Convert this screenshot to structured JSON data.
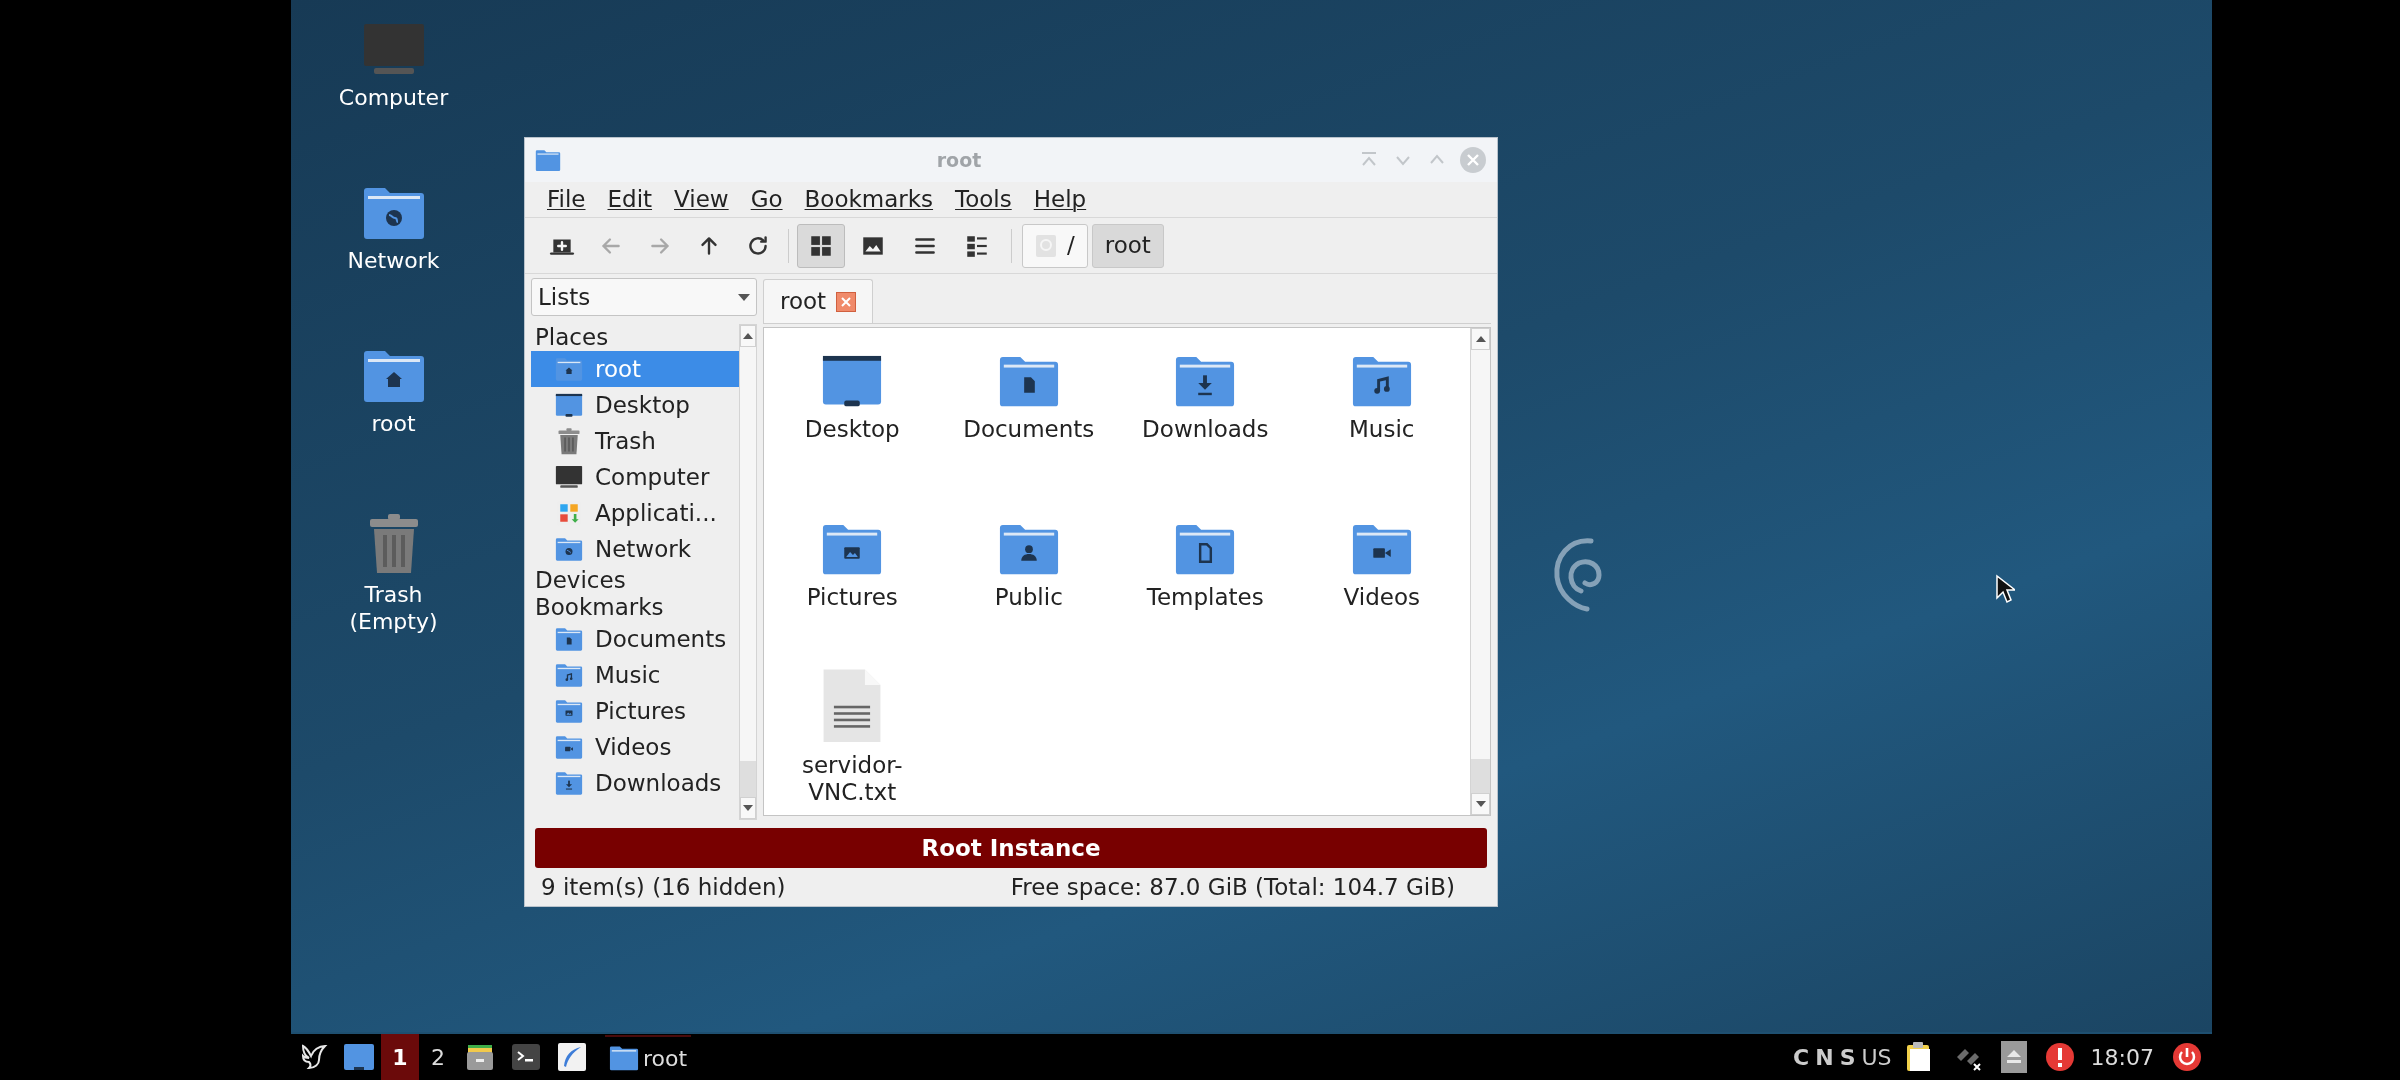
{
  "desktop": {
    "icons": [
      {
        "label": "Computer",
        "kind": "computer"
      },
      {
        "label": "Network",
        "kind": "network"
      },
      {
        "label": "root",
        "kind": "home"
      },
      {
        "label": "Trash\n(Empty)",
        "kind": "trash"
      }
    ]
  },
  "window": {
    "title": "root",
    "menu": [
      "File",
      "Edit",
      "View",
      "Go",
      "Bookmarks",
      "Tools",
      "Help"
    ],
    "toolbar": [
      {
        "kind": "new-tab",
        "disabled": false
      },
      {
        "kind": "back",
        "disabled": true
      },
      {
        "kind": "forward",
        "disabled": true
      },
      {
        "kind": "up",
        "disabled": false
      },
      {
        "kind": "reload",
        "disabled": false
      }
    ],
    "view_modes": [
      {
        "kind": "icons",
        "selected": true
      },
      {
        "kind": "thumbnails",
        "selected": false
      },
      {
        "kind": "compact",
        "selected": false
      },
      {
        "kind": "details",
        "selected": false
      }
    ],
    "path": [
      {
        "label": "/",
        "selected": false
      },
      {
        "label": "root",
        "selected": true
      }
    ],
    "side_pane_mode": "Lists",
    "sidebar": [
      {
        "title": "Places",
        "items": [
          {
            "label": "root",
            "kind": "home",
            "selected": true
          },
          {
            "label": "Desktop",
            "kind": "desktop",
            "selected": false
          },
          {
            "label": "Trash",
            "kind": "trash",
            "selected": false
          },
          {
            "label": "Computer",
            "kind": "computer",
            "selected": false
          },
          {
            "label": "Applicati...",
            "kind": "apps",
            "selected": false
          },
          {
            "label": "Network",
            "kind": "network",
            "selected": false
          }
        ]
      },
      {
        "title": "Devices"
      },
      {
        "title": "Bookmarks",
        "items": [
          {
            "label": "Documents",
            "kind": "documents",
            "selected": false
          },
          {
            "label": "Music",
            "kind": "music",
            "selected": false
          },
          {
            "label": "Pictures",
            "kind": "pictures",
            "selected": false
          },
          {
            "label": "Videos",
            "kind": "videos",
            "selected": false
          },
          {
            "label": "Downloads",
            "kind": "downloads",
            "selected": false
          }
        ]
      }
    ],
    "tabs": [
      {
        "label": "root",
        "selected": true
      }
    ],
    "files": [
      {
        "name": "Desktop",
        "kind": "desktop"
      },
      {
        "name": "Documents",
        "kind": "documents"
      },
      {
        "name": "Downloads",
        "kind": "downloads"
      },
      {
        "name": "Music",
        "kind": "music"
      },
      {
        "name": "Pictures",
        "kind": "pictures"
      },
      {
        "name": "Public",
        "kind": "public"
      },
      {
        "name": "Templates",
        "kind": "templates"
      },
      {
        "name": "Videos",
        "kind": "videos"
      },
      {
        "name": "servidor-VNC.txt",
        "kind": "text"
      }
    ],
    "banner": "Root Instance",
    "status_bar": {
      "items": "9 item(s) (16 hidden)",
      "free_space": "Free space: 87.0 GiB (Total: 104.7 GiB)"
    }
  },
  "taskbar": {
    "workspaces": [
      {
        "label": "1",
        "selected": true
      },
      {
        "label": "2",
        "selected": false
      }
    ],
    "tasks": [
      {
        "label": "root"
      }
    ],
    "indicators": [
      "C",
      "N",
      "S",
      "US"
    ],
    "clock": "18:07"
  }
}
